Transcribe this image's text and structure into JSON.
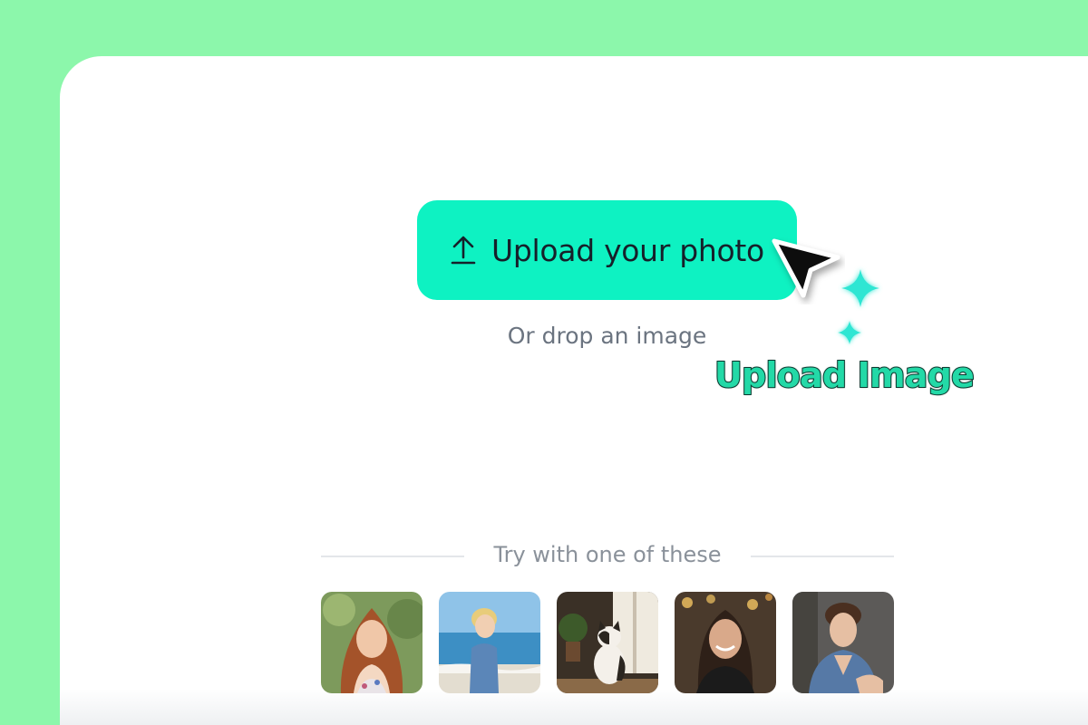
{
  "upload": {
    "button_label": "Upload your photo",
    "drop_hint": "Or drop an image",
    "icon": "upload-arrow-icon",
    "accent": "#0ef2c2"
  },
  "callout": {
    "label": "Upload Image",
    "color": "#23d9a7"
  },
  "samples": {
    "heading": "Try with one of these",
    "items": [
      {
        "name": "woman-curly-red-hair-photo"
      },
      {
        "name": "boy-on-beach-photo"
      },
      {
        "name": "cat-sitting-photo"
      },
      {
        "name": "smiling-woman-photo"
      },
      {
        "name": "young-man-denim-jacket-photo"
      }
    ]
  },
  "colors": {
    "background": "#8cf7ab",
    "card": "#ffffff"
  }
}
